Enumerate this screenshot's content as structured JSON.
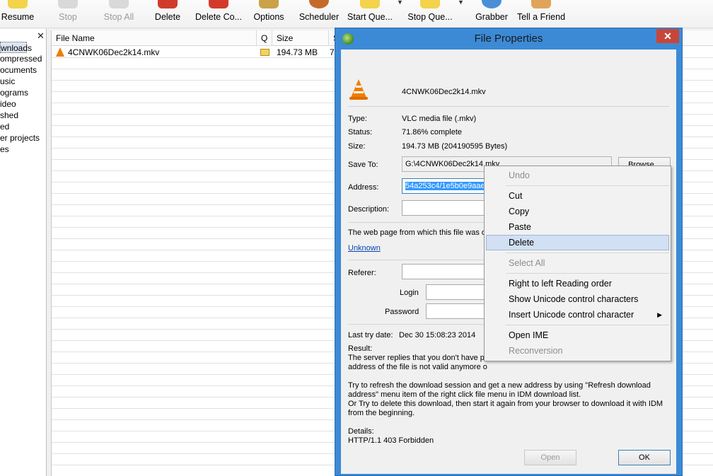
{
  "toolbar": {
    "resume": "Resume",
    "stop": "Stop",
    "stop_all": "Stop All",
    "delete": "Delete",
    "delete_completed": "Delete Co...",
    "options": "Options",
    "scheduler": "Scheduler",
    "start_queue": "Start Que...",
    "stop_queue": "Stop Que...",
    "grabber": "Grabber",
    "tell_friend": "Tell a Friend"
  },
  "categories": [
    "wnloads",
    "ompressed",
    "ocuments",
    "usic",
    "ograms",
    "ideo",
    "shed",
    "ed",
    "er projects",
    "es"
  ],
  "filelist": {
    "columns": {
      "file_name": "File Name",
      "q": "Q",
      "size": "Size",
      "status": "S"
    },
    "rows": [
      {
        "name": "4CNWK06Dec2k14.mkv",
        "size": "194.73  MB",
        "status": "7"
      }
    ]
  },
  "dialog": {
    "title": "File Properties",
    "file_name": "4CNWK06Dec2k14.mkv",
    "type_label": "Type:",
    "type_value": "VLC media file (.mkv)",
    "status_label": "Status:",
    "status_value": "71.86% complete",
    "size_label": "Size:",
    "size_value": "194.73  MB (204190595 Bytes)",
    "save_to_label": "Save To:",
    "save_to_value": "G:\\4CNWK06Dec2k14.mkv",
    "browse": "Browse...",
    "address_label": "Address:",
    "address_value": "54a253c4/1e5b0e9aae35efc1964ff6874d4e5880.avi/4CNWK06Dec2k14.mkv",
    "description_label": "Description:",
    "webpage_text": "The web page from which this file was ol",
    "unknown_link": "Unknown",
    "referer_label": "Referer:",
    "login_label": "Login",
    "password_label": "Password",
    "last_try_label": "Last try date:",
    "last_try_value": "Dec 30 15:08:23 2014",
    "result_label": "Result:",
    "result_line1": "The server replies that you don't have p",
    "result_line2": "address of the file is not valid anymore o",
    "hint_line1": "Try to refresh the download session and get a new address by using \"Refresh download",
    "hint_line2": "address\" menu item of the right click file menu in IDM download list.",
    "hint_line3": "Or Try to delete this download, then start it again from your browser to download it with IDM",
    "hint_line4": "from the beginning.",
    "details_label": "Details:",
    "details_value": "HTTP/1.1 403 Forbidden",
    "open": "Open",
    "ok": "OK"
  },
  "context_menu": {
    "undo": "Undo",
    "cut": "Cut",
    "copy": "Copy",
    "paste": "Paste",
    "delete": "Delete",
    "select_all": "Select All",
    "rtl": "Right to left Reading order",
    "show_unicode": "Show Unicode control characters",
    "insert_unicode": "Insert Unicode control character",
    "open_ime": "Open IME",
    "reconversion": "Reconversion"
  },
  "colors": {
    "dialog_border": "#3c8ad6",
    "close_button": "#c7463a",
    "selection": "#3399ff",
    "menu_highlight": "#d1e0f2"
  }
}
